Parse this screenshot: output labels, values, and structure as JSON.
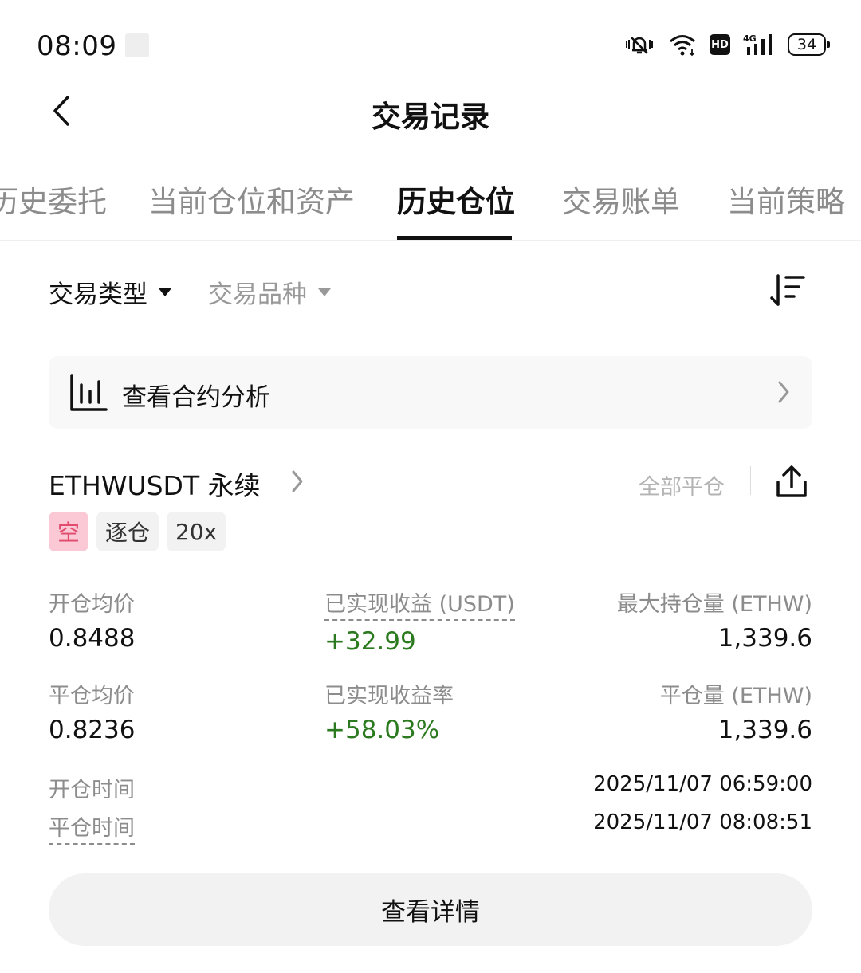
{
  "status_bar": {
    "time": "08:09",
    "network": "4G",
    "hd": "HD",
    "battery": "34"
  },
  "header": {
    "title": "交易记录"
  },
  "tabs": [
    {
      "label": "历史委托",
      "active": false
    },
    {
      "label": "当前仓位和资产",
      "active": false
    },
    {
      "label": "历史仓位",
      "active": true
    },
    {
      "label": "交易账单",
      "active": false
    },
    {
      "label": "当前策略",
      "active": false
    }
  ],
  "filters": {
    "trade_type": "交易类型",
    "trade_symbol": "交易品种"
  },
  "analysis": {
    "label": "查看合约分析"
  },
  "position": {
    "symbol": "ETHWUSDT 永续",
    "close_all": "全部平仓",
    "tags": {
      "direction": "空",
      "margin_mode": "逐仓",
      "leverage": "20x"
    },
    "open_avg_price": {
      "label": "开仓均价",
      "value": "0.8488"
    },
    "realized_pnl": {
      "label": "已实现收益 (USDT)",
      "value": "+32.99"
    },
    "max_position": {
      "label": "最大持仓量 (ETHW)",
      "value": "1,339.6"
    },
    "close_avg_price": {
      "label": "平仓均价",
      "value": "0.8236"
    },
    "realized_pnl_rate": {
      "label": "已实现收益率",
      "value": "+58.03%"
    },
    "close_amount": {
      "label": "平仓量 (ETHW)",
      "value": "1,339.6"
    },
    "open_time": {
      "label": "开仓时间",
      "value": "2025/11/07 06:59:00"
    },
    "close_time": {
      "label": "平仓时间",
      "value": "2025/11/07 08:08:51"
    },
    "detail_button": "查看详情"
  },
  "colors": {
    "profit_green": "#2c7a1f",
    "short_tag_bg": "#fbc8d5",
    "short_tag_text": "#e24a6e"
  }
}
